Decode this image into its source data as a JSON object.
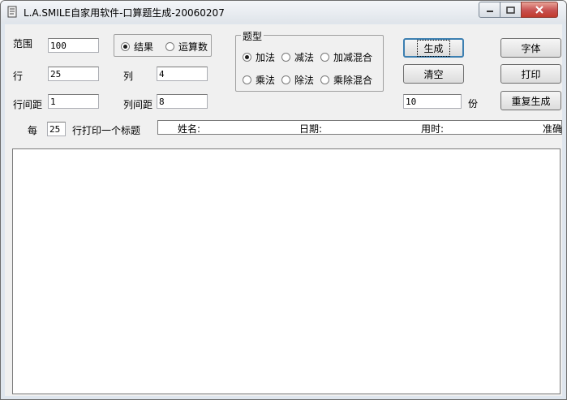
{
  "window": {
    "title": "L.A.SMILE自家用软件-口算题生成-20060207"
  },
  "fields": {
    "range": {
      "label": "范围",
      "value": "100"
    },
    "rows": {
      "label": "行",
      "value": "25"
    },
    "cols": {
      "label": "列",
      "value": "4"
    },
    "row_spacing": {
      "label": "行间距",
      "value": "1"
    },
    "col_spacing": {
      "label": "列间距",
      "value": "8"
    },
    "every": {
      "label_before": "每",
      "value": "25",
      "label_after": "行打印一个标题"
    },
    "copies": {
      "value": "10",
      "unit": "份"
    }
  },
  "result_mode": {
    "options": [
      {
        "label": "结果",
        "selected": true
      },
      {
        "label": "运算数",
        "selected": false
      }
    ]
  },
  "question_type": {
    "title": "题型",
    "options": [
      {
        "label": "加法",
        "selected": true
      },
      {
        "label": "减法",
        "selected": false
      },
      {
        "label": "加减混合",
        "selected": false
      },
      {
        "label": "乘法",
        "selected": false
      },
      {
        "label": "除法",
        "selected": false
      },
      {
        "label": "乘除混合",
        "selected": false
      }
    ]
  },
  "buttons": {
    "generate": "生成",
    "clear": "清空",
    "font": "字体",
    "print": "打印",
    "regenerate": "重复生成"
  },
  "header_strip": {
    "name": "姓名:",
    "date": "日期:",
    "time_used": "用时:",
    "accuracy": "准确"
  },
  "colors": {
    "default_button_border": "#3c7fb1",
    "close_button": "#c75050"
  }
}
